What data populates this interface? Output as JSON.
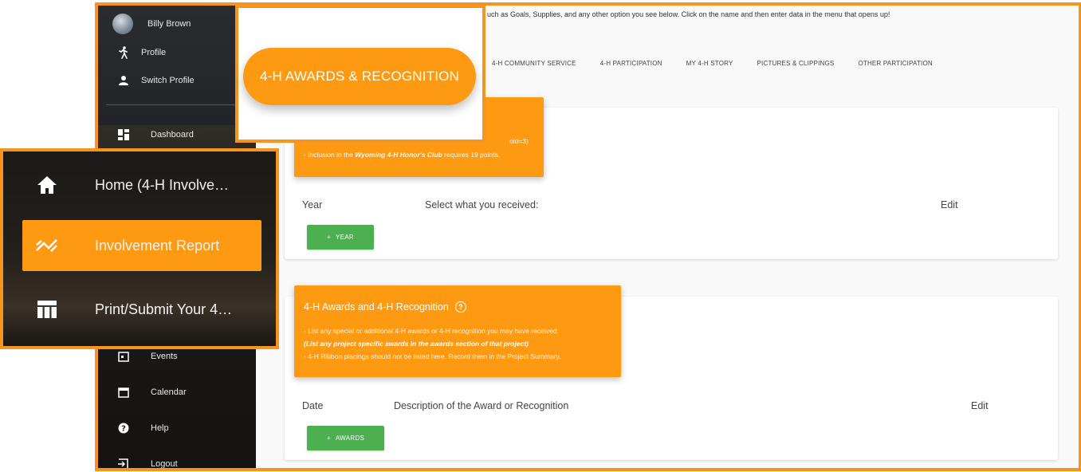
{
  "sidebar": {
    "user_name": "Billy Brown",
    "items_top": [
      {
        "label": "Profile",
        "icon": "person-walking-icon"
      },
      {
        "label": "Switch Profile",
        "icon": "person-icon"
      },
      {
        "label": "Dashboard",
        "icon": "dashboard-icon"
      }
    ],
    "items_bottom": [
      {
        "label": "Events",
        "icon": "events-icon"
      },
      {
        "label": "Calendar",
        "icon": "calendar-icon"
      },
      {
        "label": "Help",
        "icon": "help-icon"
      },
      {
        "label": "Logout",
        "icon": "logout-icon"
      }
    ]
  },
  "main": {
    "instructions": "uch as Goals, Supplies, and any other option you see below. Click on the name and then enter data in the menu that opens up!",
    "tabs": [
      "4-H COMMUNITY SERVICE",
      "4-H PARTICIPATION",
      "MY 4-H STORY",
      "PICTURES & CLIPPINGS",
      "OTHER PARTICIPATION"
    ],
    "card1": {
      "line1": "old=3)",
      "line2_pre": "- Inclusion in the ",
      "line2_bold": "Wyoming 4-H Honor's Club",
      "line2_post": " requires 19 points.",
      "col_year": "Year",
      "col_select": "Select what you received:",
      "col_edit": "Edit",
      "button": "YEAR"
    },
    "card2": {
      "title": "4-H Awards and 4-H Recognition",
      "help_glyph": "?",
      "line1": "- List any special or additional 4-H awards or 4-H recognition you may have received.",
      "line2": "(List any project specific awards in the awards section of that project)",
      "line3": "- 4-H Ribbon placings should not be listed here. Record them in the Project Summary.",
      "col_date": "Date",
      "col_desc": "Description of the Award or Recognition",
      "col_edit": "Edit",
      "button": "AWARDS"
    }
  },
  "callout_button": {
    "label": "4-H AWARDS & RECOGNITION"
  },
  "callout_menu": {
    "items": [
      {
        "label": "Home (4-H Involve…",
        "icon": "home-icon"
      },
      {
        "label": "Involvement Report",
        "icon": "trending-icon"
      },
      {
        "label": "Print/Submit Your 4…",
        "icon": "table-icon"
      }
    ]
  },
  "colors": {
    "accent": "#fd9a12",
    "border": "#f7941d",
    "button_green": "#4caf50"
  }
}
